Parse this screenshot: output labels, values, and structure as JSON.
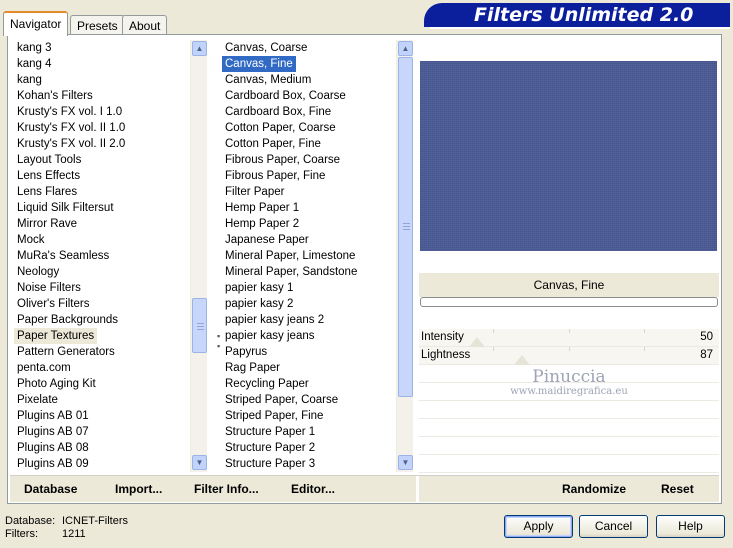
{
  "tabs": [
    "Navigator",
    "Presets",
    "About"
  ],
  "banner": {
    "title": "Filters Unlimited 2.0"
  },
  "categories": {
    "items": [
      "kang 3",
      "kang 4",
      "kang",
      "Kohan's Filters",
      "Krusty's FX vol. I 1.0",
      "Krusty's FX vol. II 1.0",
      "Krusty's FX vol. II 2.0",
      "Layout Tools",
      "Lens Effects",
      "Lens Flares",
      "Liquid Silk Filtersut",
      "Mirror Rave",
      "Mock",
      "MuRa's Seamless",
      "Neology",
      "Noise Filters",
      "Oliver's Filters",
      "Paper Backgrounds",
      "Paper Textures",
      "Pattern Generators",
      "penta.com",
      "Photo Aging Kit",
      "Pixelate",
      "Plugins AB 01",
      "Plugins AB 07",
      "Plugins AB 08",
      "Plugins AB 09"
    ],
    "current": "Paper Textures"
  },
  "filters": {
    "items": [
      "Canvas, Coarse",
      "Canvas, Fine",
      "Canvas, Medium",
      "Cardboard Box, Coarse",
      "Cardboard Box, Fine",
      "Cotton Paper, Coarse",
      "Cotton Paper, Fine",
      "Fibrous Paper, Coarse",
      "Fibrous Paper, Fine",
      "Filter Paper",
      "Hemp Paper 1",
      "Hemp Paper 2",
      "Japanese Paper",
      "Mineral Paper, Limestone",
      "Mineral Paper, Sandstone",
      "papier kasy 1",
      "papier kasy 2",
      "papier kasy jeans 2",
      "papier kasy jeans",
      "Papyrus",
      "Rag Paper",
      "Recycling Paper",
      "Striped Paper, Coarse",
      "Striped Paper, Fine",
      "Structure Paper 1",
      "Structure Paper 2",
      "Structure Paper 3"
    ],
    "selected": "Canvas, Fine"
  },
  "preview": {
    "filter_name": "Canvas, Fine",
    "color": "#4a5a95"
  },
  "sliders": [
    {
      "label": "Intensity",
      "value": "50"
    },
    {
      "label": "Lightness",
      "value": "87"
    }
  ],
  "watermark": {
    "name": "Pinuccia",
    "url": "www.maidiregrafica.eu"
  },
  "bottom_bar": {
    "database": "Database",
    "import": "Import...",
    "filter_info": "Filter Info...",
    "editor": "Editor...",
    "randomize": "Randomize",
    "reset": "Reset"
  },
  "db_info": {
    "database_label": "Database:",
    "database_value": "ICNET-Filters",
    "filters_label": "Filters:",
    "filters_value": "1211"
  },
  "buttons": {
    "apply": "Apply",
    "cancel": "Cancel",
    "help": "Help"
  }
}
